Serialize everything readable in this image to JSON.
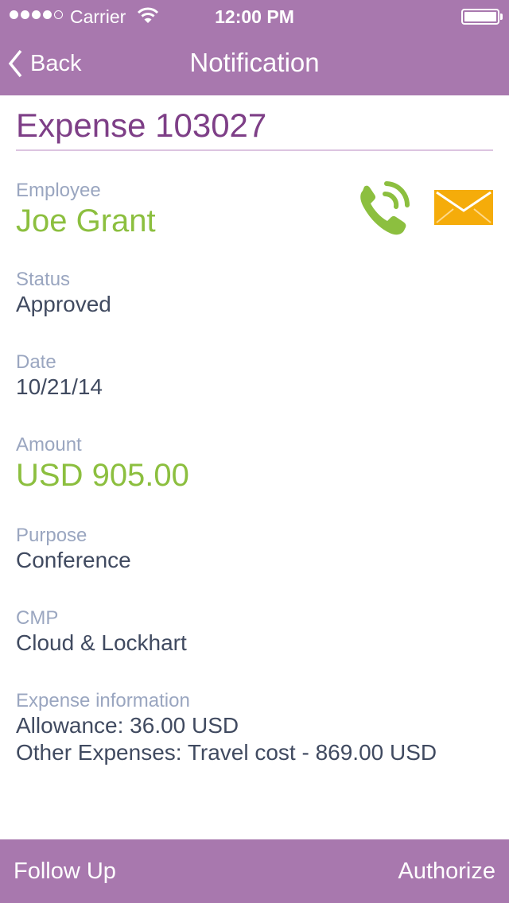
{
  "status_bar": {
    "signal_bars_filled": 4,
    "signal_bars_total": 5,
    "carrier": "Carrier",
    "time": "12:00 PM",
    "battery_level": 1.0
  },
  "nav": {
    "back_label": "Back",
    "title": "Notification"
  },
  "expense": {
    "title": "Expense 103027",
    "employee": {
      "label": "Employee",
      "value": "Joe Grant"
    },
    "status": {
      "label": "Status",
      "value": "Approved"
    },
    "date": {
      "label": "Date",
      "value": "10/21/14"
    },
    "amount": {
      "label": "Amount",
      "value": "USD 905.00"
    },
    "purpose": {
      "label": "Purpose",
      "value": "Conference"
    },
    "cmp": {
      "label": "CMP",
      "value": "Cloud & Lockhart"
    },
    "expense_info": {
      "label": "Expense information",
      "lines": [
        "Allowance: 36.00 USD",
        "Other Expenses: Travel cost - 869.00 USD"
      ]
    }
  },
  "contact_actions": [
    {
      "icon": "phone-icon",
      "color": "#8cbf3f"
    },
    {
      "icon": "mail-icon",
      "color": "#f5ac0a"
    }
  ],
  "bottom_bar": {
    "follow_up_label": "Follow Up",
    "authorize_label": "Authorize"
  },
  "colors": {
    "brand": "#a878ae",
    "title": "#7e3f87",
    "accent_green": "#8cbf3f",
    "label": "#9aa6c0",
    "value": "#404a60"
  }
}
